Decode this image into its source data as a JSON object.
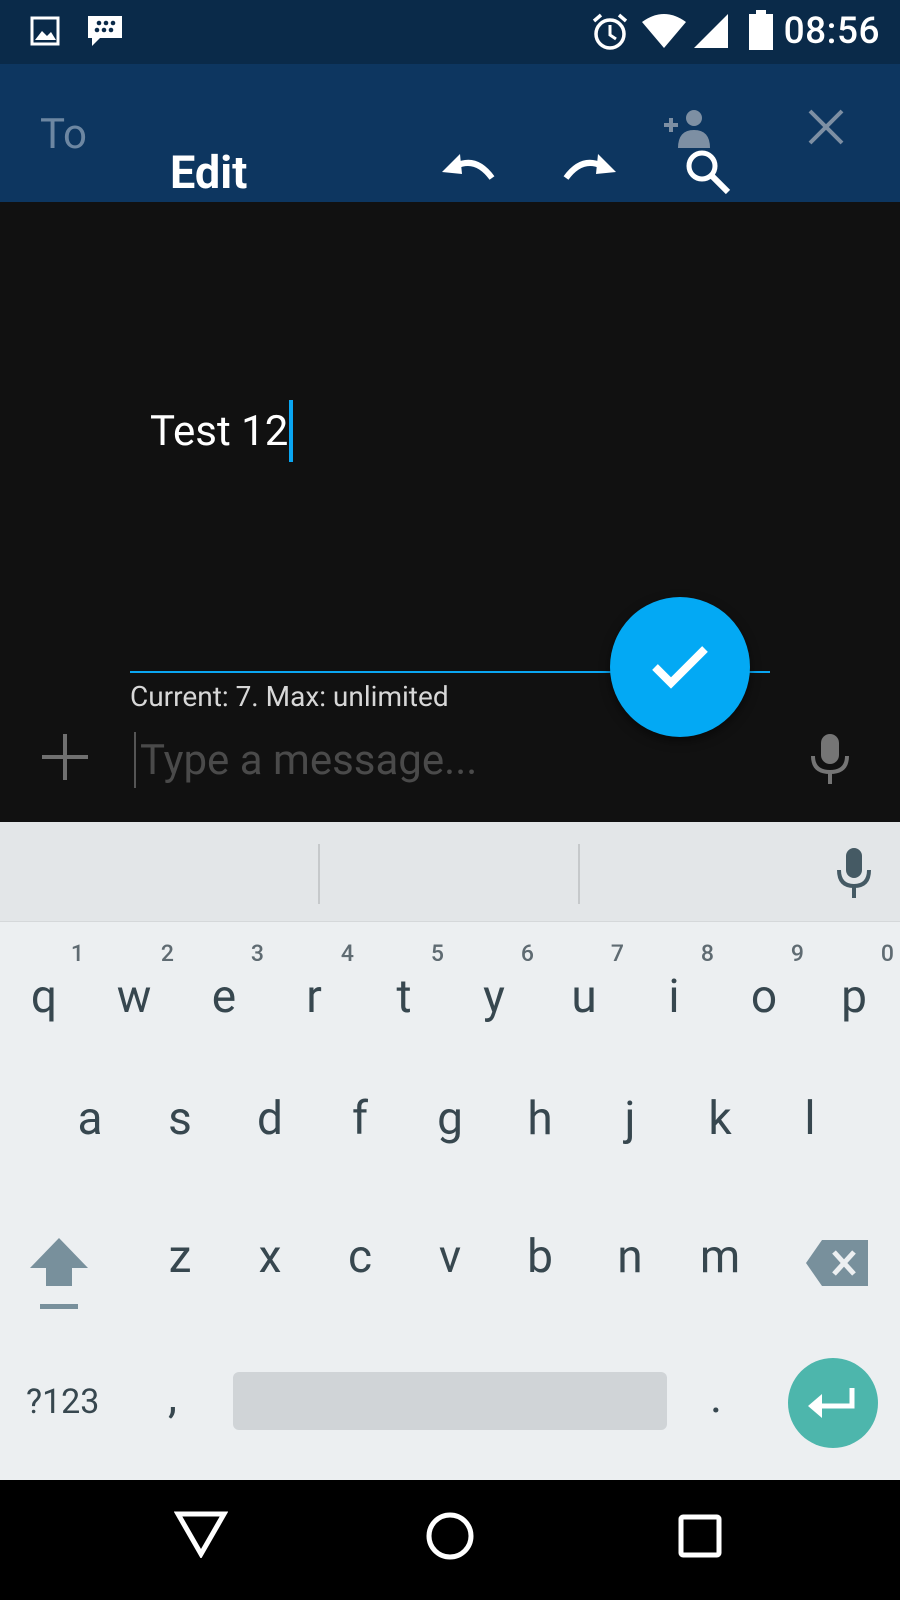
{
  "status_bar": {
    "time": "08:56",
    "icons": [
      "gallery-notification-icon",
      "bbm-notification-icon",
      "alarm-icon",
      "wifi-icon",
      "cell-signal-icon",
      "battery-icon"
    ]
  },
  "app_bar": {
    "to_label": "To",
    "title": "Edit",
    "icons": [
      "add-contact-icon",
      "close-icon",
      "undo-icon",
      "redo-icon",
      "search-icon"
    ]
  },
  "editor": {
    "text": "Test 12",
    "counter": "Current: 7. Max: unlimited"
  },
  "compose": {
    "placeholder": "Type a message..."
  },
  "keyboard": {
    "row1": [
      {
        "ch": "q",
        "hint": "1"
      },
      {
        "ch": "w",
        "hint": "2"
      },
      {
        "ch": "e",
        "hint": "3"
      },
      {
        "ch": "r",
        "hint": "4"
      },
      {
        "ch": "t",
        "hint": "5"
      },
      {
        "ch": "y",
        "hint": "6"
      },
      {
        "ch": "u",
        "hint": "7"
      },
      {
        "ch": "i",
        "hint": "8"
      },
      {
        "ch": "o",
        "hint": "9"
      },
      {
        "ch": "p",
        "hint": "0"
      }
    ],
    "row2": [
      "a",
      "s",
      "d",
      "f",
      "g",
      "h",
      "j",
      "k",
      "l"
    ],
    "row3": [
      "z",
      "x",
      "c",
      "v",
      "b",
      "n",
      "m"
    ],
    "symbols_label": "?123",
    "comma": ",",
    "period": "."
  },
  "colors": {
    "status_bar": "#0a2a49",
    "app_bar": "#0d3660",
    "accent": "#03a9f4",
    "enter_key": "#4db6ac",
    "keyboard_bg": "#eceff1"
  }
}
